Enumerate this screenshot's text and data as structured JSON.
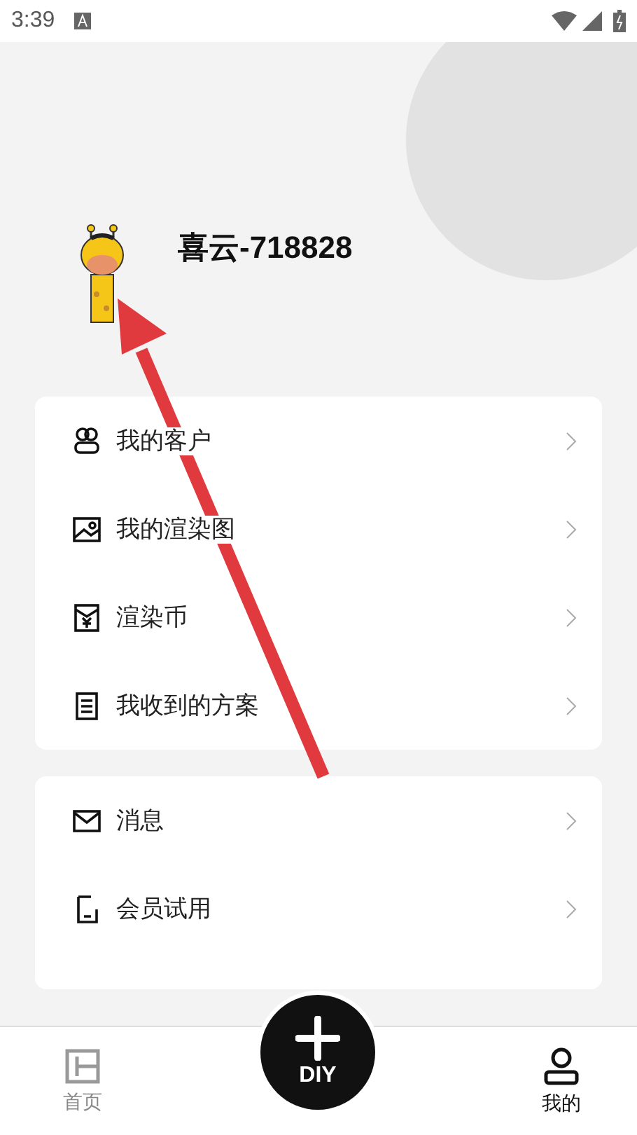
{
  "status_bar": {
    "time": "3:39"
  },
  "profile": {
    "name": "喜云-718828"
  },
  "menu_groups": [
    {
      "items": [
        {
          "label": "我的客户"
        },
        {
          "label": "我的渲染图"
        },
        {
          "label": "渲染币"
        },
        {
          "label": "我收到的方案"
        }
      ]
    },
    {
      "items": [
        {
          "label": "消息"
        },
        {
          "label": "会员试用"
        }
      ]
    }
  ],
  "bottom_nav": {
    "tabs": [
      {
        "label": "首页",
        "selected": false
      },
      {
        "label": "我的",
        "selected": true
      }
    ],
    "center_button": {
      "label": "DIY"
    }
  }
}
